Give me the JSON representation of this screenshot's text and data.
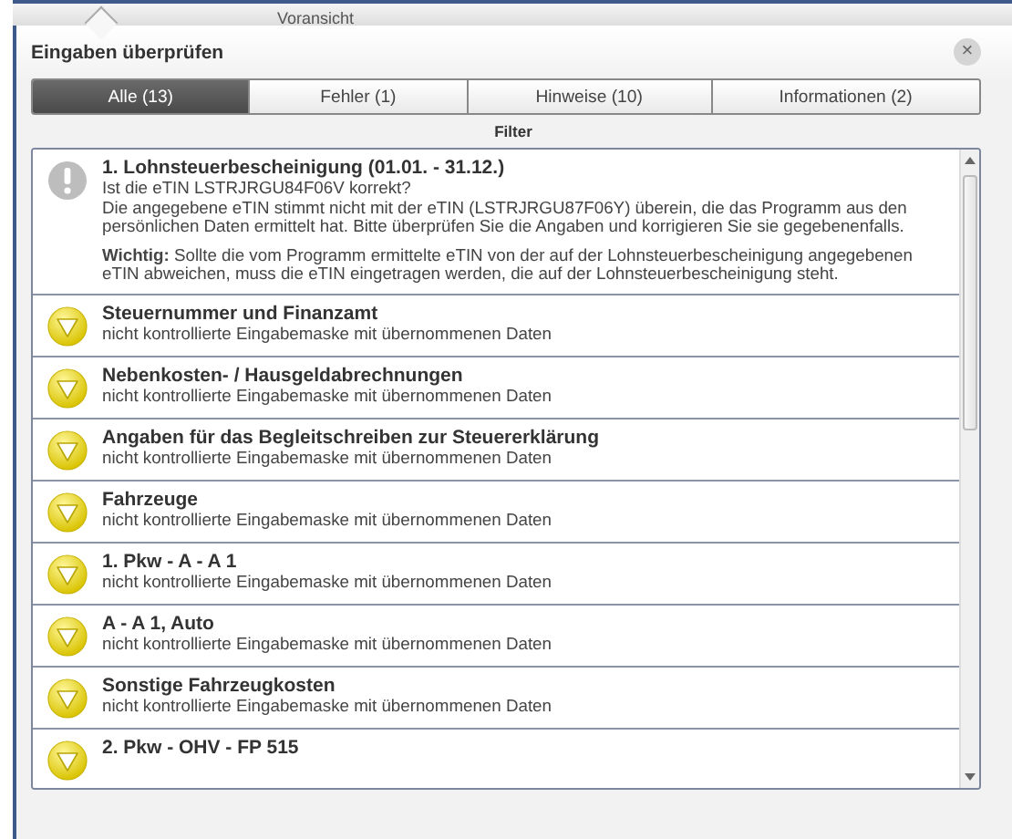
{
  "background": {
    "tab_label": "Voransicht"
  },
  "dialog": {
    "title": "Eingaben überprüfen",
    "close": "×"
  },
  "tabs": [
    {
      "label": "Alle (13)",
      "selected": true
    },
    {
      "label": "Fehler (1)",
      "selected": false
    },
    {
      "label": "Hinweise (10)",
      "selected": false
    },
    {
      "label": "Informationen (2)",
      "selected": false
    }
  ],
  "filter_label": "Filter",
  "items": [
    {
      "kind": "error",
      "title": "1. Lohnsteuerbescheinigung (01.01. - 31.12.)",
      "lines": [
        "Ist die eTIN LSTRJRGU84F06V korrekt?",
        "Die angegebene eTIN stimmt nicht mit der eTIN (LSTRJRGU87F06Y) überein, die das Programm aus den persönlichen Daten ermittelt hat. Bitte überprüfen Sie die Angaben und korrigieren Sie sie gegebenenfalls."
      ],
      "note": "**Wichtig:** Sollte die vom Programm ermittelte eTIN von der auf der Lohnsteuerbescheinigung angegebenen eTIN abweichen, muss die eTIN eingetragen werden, die auf der Lohnsteuerbescheinigung steht."
    },
    {
      "kind": "hint",
      "title": "Steuernummer und Finanzamt",
      "lines": [
        "nicht kontrollierte Eingabemaske mit übernommenen Daten"
      ]
    },
    {
      "kind": "hint",
      "title": "Nebenkosten- / Hausgeldabrechnungen",
      "lines": [
        "nicht kontrollierte Eingabemaske mit übernommenen Daten"
      ]
    },
    {
      "kind": "hint",
      "title": "Angaben für das Begleitschreiben zur Steuererklärung",
      "lines": [
        "nicht kontrollierte Eingabemaske mit übernommenen Daten"
      ]
    },
    {
      "kind": "hint",
      "title": "Fahrzeuge",
      "lines": [
        "nicht kontrollierte Eingabemaske mit übernommenen Daten"
      ]
    },
    {
      "kind": "hint",
      "title": "1. Pkw - A - A 1",
      "lines": [
        "nicht kontrollierte Eingabemaske mit übernommenen Daten"
      ]
    },
    {
      "kind": "hint",
      "title": "A - A 1, Auto",
      "lines": [
        "nicht kontrollierte Eingabemaske mit übernommenen Daten"
      ]
    },
    {
      "kind": "hint",
      "title": "Sonstige Fahrzeugkosten",
      "lines": [
        "nicht kontrollierte Eingabemaske mit übernommenen Daten"
      ]
    },
    {
      "kind": "hint",
      "title": "2. Pkw - OHV - FP 515"
    }
  ]
}
